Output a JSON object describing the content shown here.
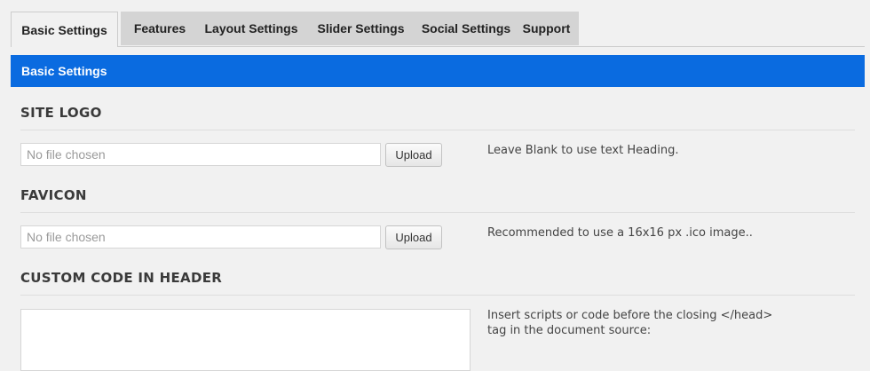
{
  "tabs": [
    {
      "label": "Basic Settings",
      "active": true
    },
    {
      "label": "Features"
    },
    {
      "label": "Layout Settings"
    },
    {
      "label": "Slider Settings"
    },
    {
      "label": "Social Settings"
    },
    {
      "label": "Support"
    }
  ],
  "panel": {
    "title": "Basic Settings"
  },
  "sections": {
    "site_logo": {
      "title": "SITE LOGO",
      "file_value": "No file chosen",
      "upload_label": "Upload",
      "help": "Leave Blank to use text Heading."
    },
    "favicon": {
      "title": "FAVICON",
      "file_value": "No file chosen",
      "upload_label": "Upload",
      "help": "Recommended to use a 16x16 px .ico image.."
    },
    "custom_code_header": {
      "title": "CUSTOM CODE IN HEADER",
      "help": "Insert scripts or code before the closing </head> tag in the document source:"
    }
  },
  "colors": {
    "accent": "#0a6be0",
    "tab_bg": "#d4d4d4",
    "page_bg": "#f1f1f1"
  }
}
